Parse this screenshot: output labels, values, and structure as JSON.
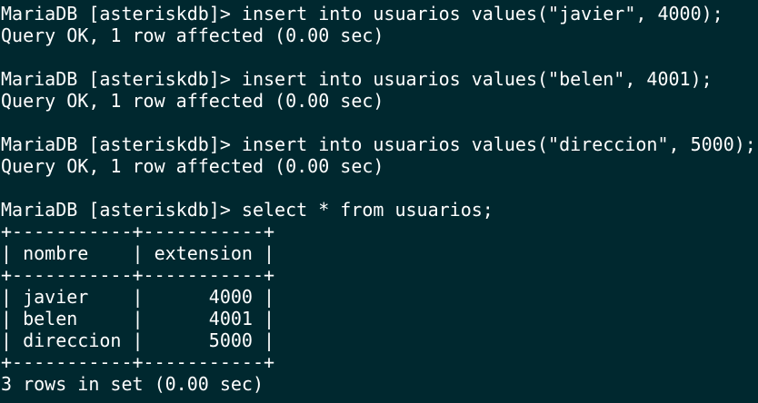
{
  "terminal": {
    "lines": [
      "MariaDB [asteriskdb]> insert into usuarios values(\"javier\", 4000);",
      "Query OK, 1 row affected (0.00 sec)",
      "",
      "MariaDB [asteriskdb]> insert into usuarios values(\"belen\", 4001);",
      "Query OK, 1 row affected (0.00 sec)",
      "",
      "MariaDB [asteriskdb]> insert into usuarios values(\"direccion\", 5000);",
      "Query OK, 1 row affected (0.00 sec)",
      "",
      "MariaDB [asteriskdb]> select * from usuarios;",
      "+-----------+-----------+",
      "| nombre    | extension |",
      "+-----------+-----------+",
      "| javier    |      4000 |",
      "| belen     |      4001 |",
      "| direccion |      5000 |",
      "+-----------+-----------+",
      "3 rows in set (0.00 sec)"
    ]
  }
}
